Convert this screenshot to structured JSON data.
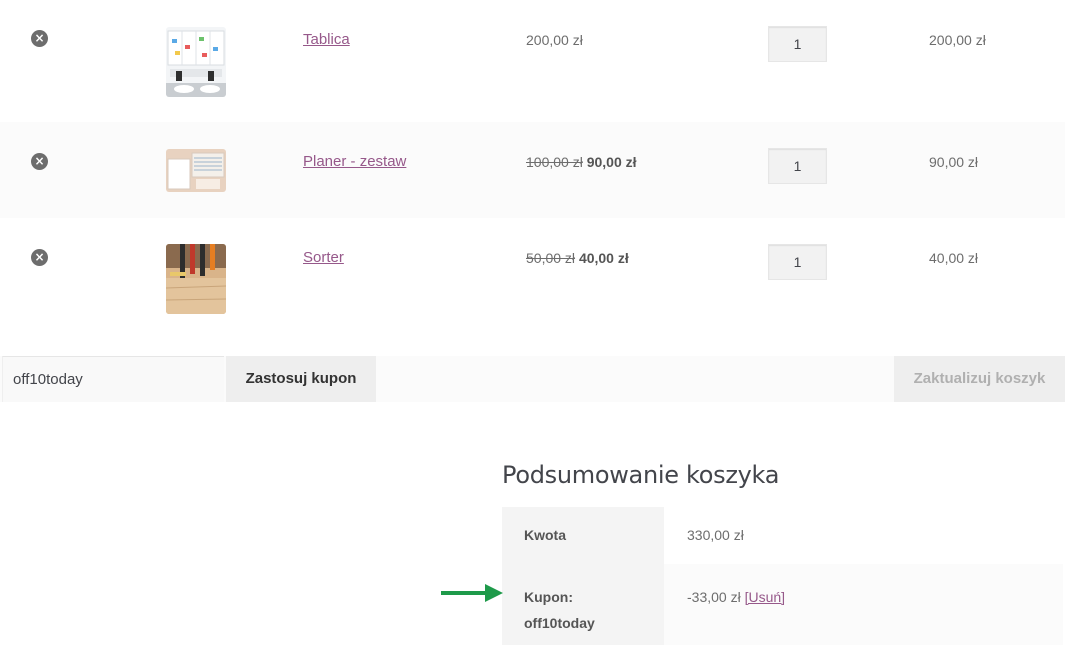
{
  "cart": {
    "items": [
      {
        "name": "Tablica",
        "price_regular": "200,00 zł",
        "price_old": "",
        "price_sale": "",
        "qty": "1",
        "subtotal": "200,00 zł",
        "remove_label": "×"
      },
      {
        "name": "Planer - zestaw",
        "price_regular": "",
        "price_old": "100,00 zł",
        "price_sale": "90,00 zł",
        "qty": "1",
        "subtotal": "90,00 zł",
        "remove_label": "×"
      },
      {
        "name": "Sorter",
        "price_regular": "",
        "price_old": "50,00 zł",
        "price_sale": "40,00 zł",
        "qty": "1",
        "subtotal": "40,00 zł",
        "remove_label": "×"
      }
    ],
    "coupon_code": "off10today",
    "apply_coupon_label": "Zastosuj kupon",
    "update_cart_label": "Zaktualizuj koszyk"
  },
  "totals": {
    "title": "Podsumowanie koszyka",
    "subtotal_label": "Kwota",
    "subtotal_value": "330,00 zł",
    "coupon_label_prefix": "Kupon:",
    "coupon_label_code": "off10today",
    "coupon_value": "-33,00 zł",
    "coupon_remove_label": "[Usuń]"
  },
  "colors": {
    "link": "#96588a",
    "arrow": "#1e9a4a",
    "button_bg": "#eeeeee"
  }
}
